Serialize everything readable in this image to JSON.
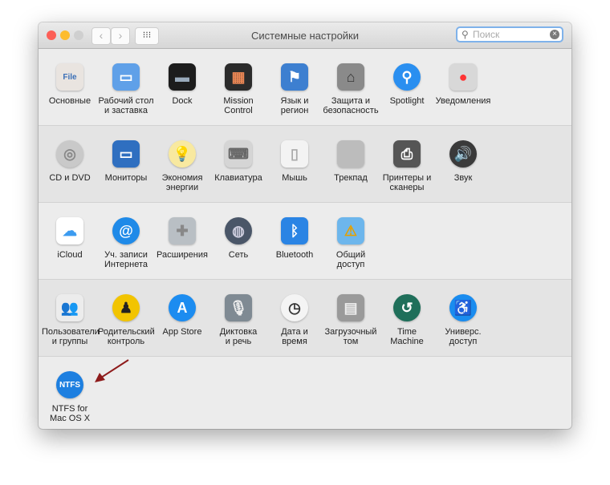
{
  "window": {
    "title": "Системные настройки",
    "search_placeholder": "Поиск"
  },
  "colors": {
    "close": "#fc5f57",
    "minimize": "#fdbc2e",
    "zoom": "#cfcfcf",
    "arrow": "#8e1b1b"
  },
  "sections": [
    [
      {
        "label": "Основные",
        "icon": "general-icon",
        "bg": "#e9e4e0",
        "fg": "#3a6fb7",
        "glyph": "File"
      },
      {
        "label": "Рабочий стол\nи заставка",
        "icon": "desktop-icon",
        "bg": "#5fa0e8",
        "fg": "#fff",
        "glyph": "▭"
      },
      {
        "label": "Dock",
        "icon": "dock-icon",
        "bg": "#1c1c1c",
        "fg": "#9ab",
        "glyph": "▬"
      },
      {
        "label": "Mission\nControl",
        "icon": "mission-control-icon",
        "bg": "#2b2b2b",
        "fg": "#e85",
        "glyph": "▦"
      },
      {
        "label": "Язык и\nрегион",
        "icon": "flag-icon",
        "bg": "#3d7fd0",
        "fg": "#fff",
        "glyph": "⚑"
      },
      {
        "label": "Защита и\nбезопасность",
        "icon": "security-house-icon",
        "bg": "#8a8a8a",
        "fg": "#333",
        "glyph": "⌂"
      },
      {
        "label": "Spotlight",
        "icon": "spotlight-icon",
        "bg": "#2a8ff0",
        "fg": "#fff",
        "glyph": "⚲",
        "round": true
      },
      {
        "label": "Уведомления",
        "icon": "notifications-icon",
        "bg": "#d8d8d8",
        "fg": "#f33",
        "glyph": "●"
      }
    ],
    [
      {
        "label": "CD и DVD",
        "icon": "cd-dvd-icon",
        "bg": "#c9c9c9",
        "fg": "#888",
        "glyph": "◎",
        "round": true
      },
      {
        "label": "Мониторы",
        "icon": "monitor-icon",
        "bg": "#2f6fc0",
        "fg": "#fff",
        "glyph": "▭"
      },
      {
        "label": "Экономия\nэнергии",
        "icon": "lightbulb-icon",
        "bg": "#f8e9a0",
        "fg": "#b89a20",
        "glyph": "💡",
        "round": true
      },
      {
        "label": "Клавиатура",
        "icon": "keyboard-icon",
        "bg": "#d5d5d5",
        "fg": "#666",
        "glyph": "⌨"
      },
      {
        "label": "Мышь",
        "icon": "mouse-icon",
        "bg": "#f3f3f3",
        "fg": "#aaa",
        "glyph": "▯"
      },
      {
        "label": "Трекпад",
        "icon": "trackpad-icon",
        "bg": "#bcbcbc",
        "fg": "#bcbcbc",
        "glyph": ""
      },
      {
        "label": "Принтеры и\nсканеры",
        "icon": "printer-icon",
        "bg": "#555",
        "fg": "#fff",
        "glyph": "⎙"
      },
      {
        "label": "Звук",
        "icon": "speaker-icon",
        "bg": "#3a3a3a",
        "fg": "#ddd",
        "glyph": "🔊",
        "round": true
      }
    ],
    [
      {
        "label": "iCloud",
        "icon": "icloud-icon",
        "bg": "#ffffff",
        "fg": "#3c9bf0",
        "glyph": "☁"
      },
      {
        "label": "Уч. записи\nИнтернета",
        "icon": "at-icon",
        "bg": "#1f8ae8",
        "fg": "#fff",
        "glyph": "@",
        "round": true
      },
      {
        "label": "Расширения",
        "icon": "puzzle-icon",
        "bg": "#b9bfc4",
        "fg": "#888",
        "glyph": "✚"
      },
      {
        "label": "Сеть",
        "icon": "network-globe-icon",
        "bg": "#4a5668",
        "fg": "#ccd",
        "glyph": "◍",
        "round": true
      },
      {
        "label": "Bluetooth",
        "icon": "bluetooth-icon",
        "bg": "#2a84e4",
        "fg": "#fff",
        "glyph": "ᛒ"
      },
      {
        "label": "Общий\nдоступ",
        "icon": "sharing-folder-icon",
        "bg": "#6db6ec",
        "fg": "#e6a000",
        "glyph": "⚠"
      }
    ],
    [
      {
        "label": "Пользователи\nи группы",
        "icon": "users-icon",
        "bg": "#ececec",
        "fg": "#222",
        "glyph": "👥"
      },
      {
        "label": "Родительский\nконтроль",
        "icon": "parental-control-icon",
        "bg": "#f2c400",
        "fg": "#222",
        "glyph": "♟",
        "round": true
      },
      {
        "label": "App Store",
        "icon": "app-store-icon",
        "bg": "#1c8cf0",
        "fg": "#fff",
        "glyph": "A",
        "round": true
      },
      {
        "label": "Диктовка\nи речь",
        "icon": "microphone-icon",
        "bg": "#7f8a93",
        "fg": "#eee",
        "glyph": "🎙"
      },
      {
        "label": "Дата и\nвремя",
        "icon": "clock-calendar-icon",
        "bg": "#f4f4f4",
        "fg": "#333",
        "glyph": "◷",
        "round": true
      },
      {
        "label": "Загрузочный\nтом",
        "icon": "startup-disk-icon",
        "bg": "#9a9a9a",
        "fg": "#eee",
        "glyph": "▤"
      },
      {
        "label": "Time\nMachine",
        "icon": "time-machine-icon",
        "bg": "#1f6f5a",
        "fg": "#fff",
        "glyph": "↺",
        "round": true
      },
      {
        "label": "Универс.\nдоступ",
        "icon": "accessibility-icon",
        "bg": "#1a8cef",
        "fg": "#fff",
        "glyph": "♿",
        "round": true
      }
    ],
    [
      {
        "label": "NTFS for\nMac OS X",
        "icon": "ntfs-icon",
        "bg": "#1d7fe0",
        "fg": "#fff",
        "glyph": "NTFS",
        "round": true
      }
    ]
  ]
}
